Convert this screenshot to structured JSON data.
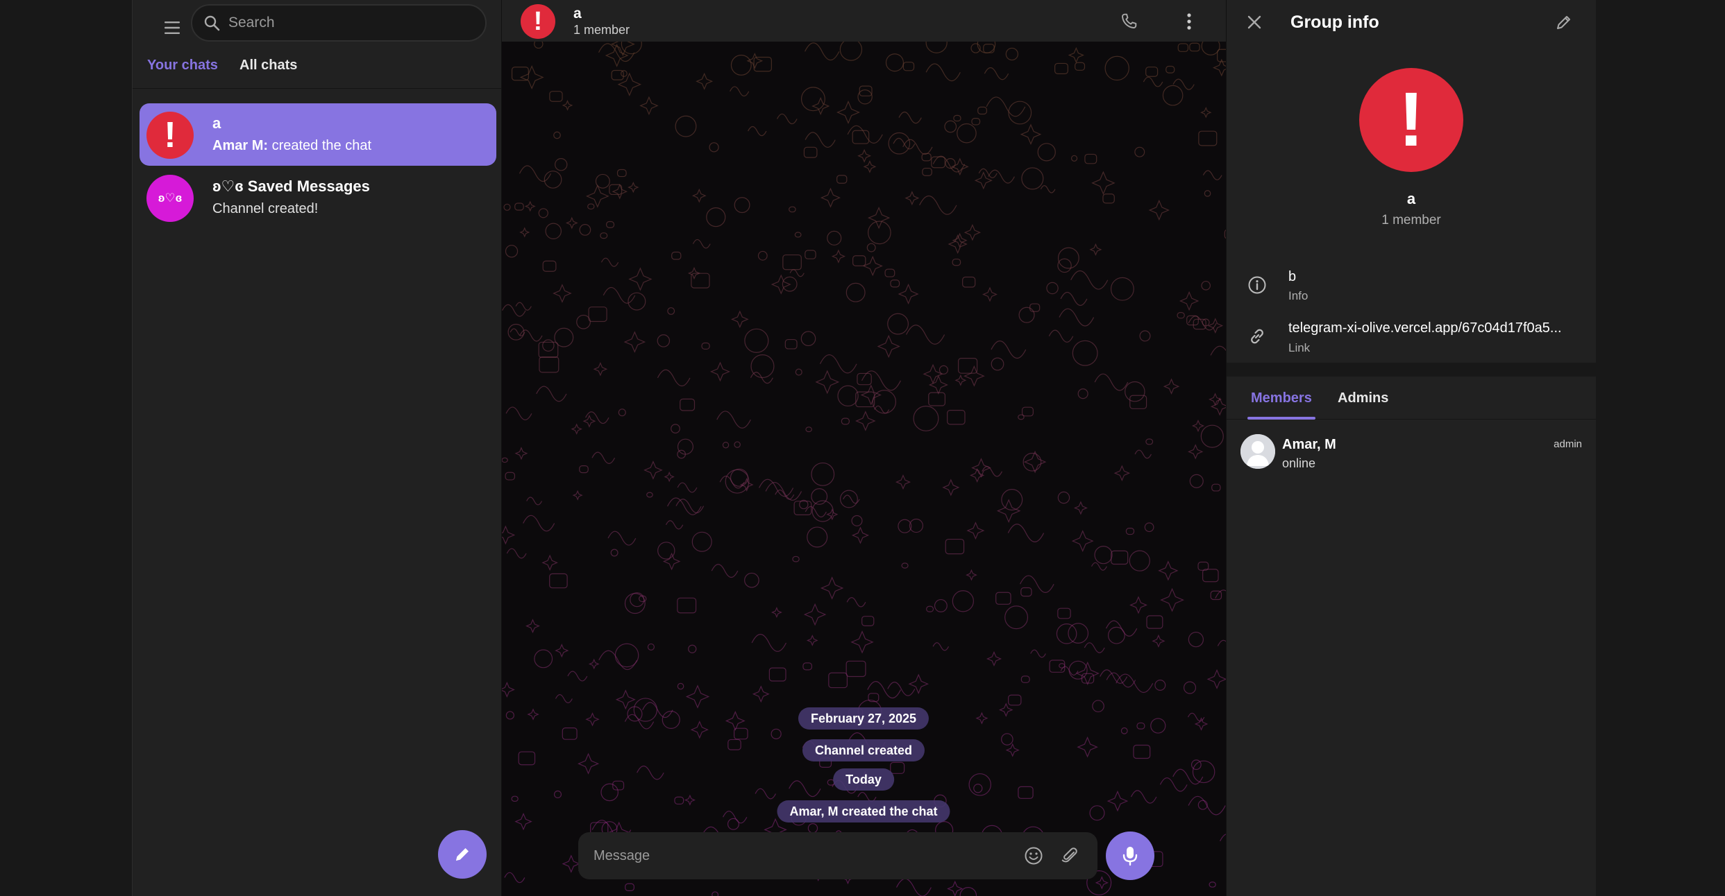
{
  "sidebar": {
    "search_placeholder": "Search",
    "tabs": [
      {
        "label": "Your chats",
        "active": true
      },
      {
        "label": "All chats",
        "active": false
      }
    ],
    "chats": [
      {
        "avatar_text": "!",
        "avatar_color": "#e02a3b",
        "title": "a",
        "sender": "Amar M:",
        "preview": "created the chat",
        "selected": true
      },
      {
        "avatar_text": "ʚ♡ɞ",
        "avatar_color": "#d61ad8",
        "title": "ʚ♡ɞ Saved Messages",
        "preview": "Channel created!",
        "selected": false
      }
    ],
    "compose_icon": "pencil-icon"
  },
  "chat": {
    "header": {
      "avatar_text": "!",
      "title": "a",
      "subtitle": "1 member",
      "icons": [
        "phone-icon",
        "more-vertical-icon"
      ]
    },
    "service_messages": [
      "February 27, 2025",
      "Channel created",
      "Today",
      "Amar, M created the chat"
    ],
    "composer": {
      "placeholder": "Message",
      "icons": [
        "emoji-icon",
        "attach-icon",
        "microphone-icon"
      ]
    }
  },
  "info_panel": {
    "title": "Group info",
    "avatar_text": "!",
    "name": "a",
    "members_count": "1 member",
    "description": {
      "value": "b",
      "label": "Info"
    },
    "link": {
      "value": "telegram-xi-olive.vercel.app/67c04d17f0a5...",
      "label": "Link"
    },
    "tabs": [
      {
        "label": "Members",
        "active": true
      },
      {
        "label": "Admins",
        "active": false
      }
    ],
    "members": [
      {
        "name": "Amar, M",
        "status": "online",
        "role": "admin"
      }
    ]
  },
  "colors": {
    "accent": "#8774e1",
    "group_red": "#e02a3b",
    "saved_magenta": "#d61ad8",
    "panel_bg": "#212121",
    "app_bg": "#181818"
  }
}
